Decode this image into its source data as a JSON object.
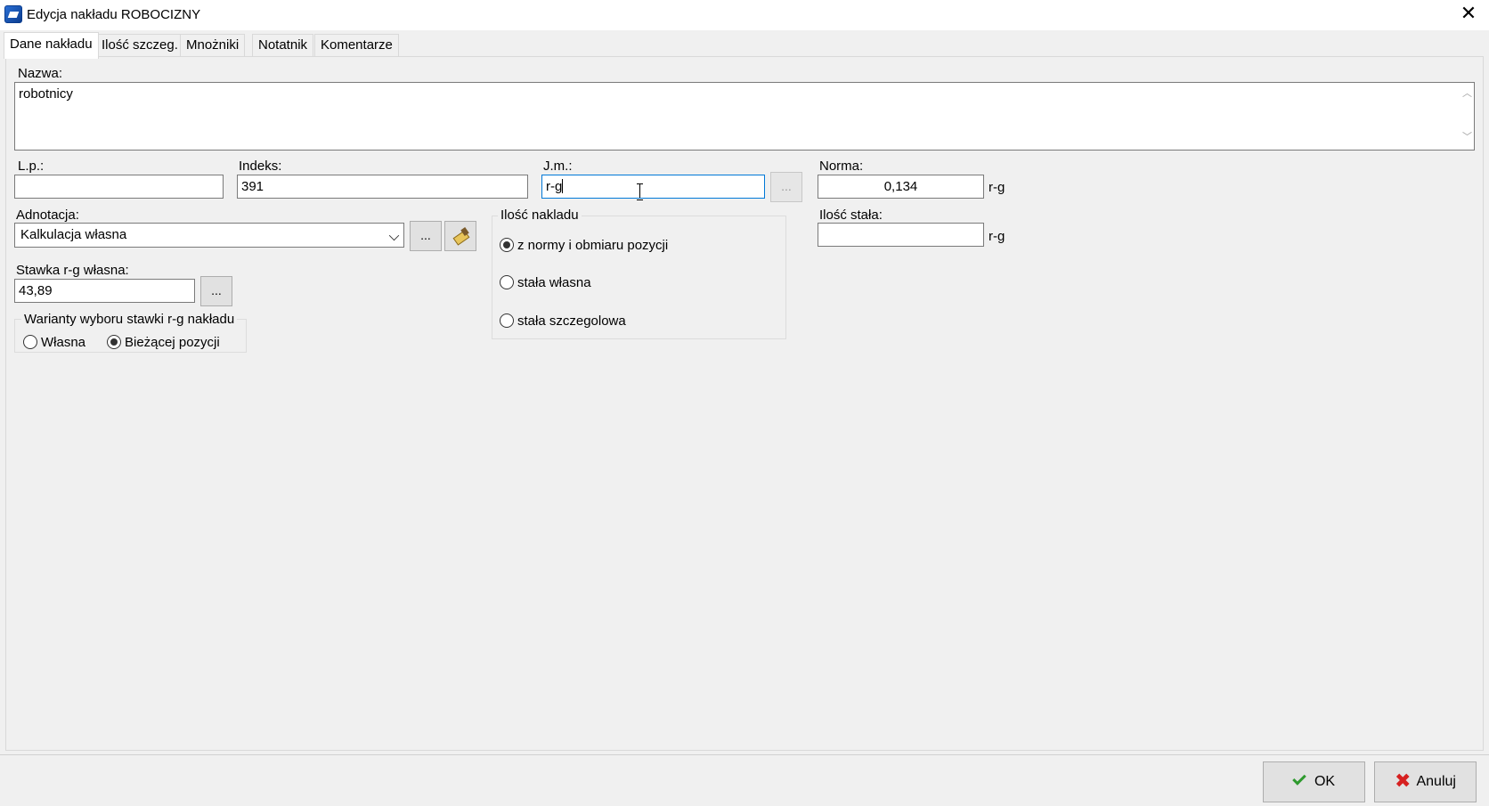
{
  "window": {
    "title": "Edycja nakładu ROBOCIZNY",
    "close": "✕"
  },
  "tabs": [
    {
      "label": "Dane nakładu",
      "active": true
    },
    {
      "label": "Ilość szczeg."
    },
    {
      "label": "Mnożniki"
    },
    {
      "label": "Notatnik"
    },
    {
      "label": "Komentarze"
    }
  ],
  "form": {
    "nazwa": {
      "label": "Nazwa:",
      "value": "robotnicy"
    },
    "lp": {
      "label": "L.p.:",
      "value": ""
    },
    "indeks": {
      "label": "Indeks:",
      "value": "391"
    },
    "jm": {
      "label": "J.m.:",
      "value": "r-g",
      "button": "..."
    },
    "norma": {
      "label": "Norma:",
      "value": "0,134",
      "unit": "r-g"
    },
    "adnotacja": {
      "label": "Adnotacja:",
      "value": "Kalkulacja własna",
      "button": "..."
    },
    "ilosc_stala": {
      "label": "Ilość stała:",
      "value": "",
      "unit": "r-g"
    },
    "stawka": {
      "label": "Stawka r-g własna:",
      "value": "43,89",
      "button": "..."
    },
    "warianty": {
      "title": "Warianty wyboru stawki r-g nakładu",
      "options": [
        {
          "label": "Własna",
          "checked": false
        },
        {
          "label": "Bieżącej pozycji",
          "checked": true
        }
      ]
    },
    "ilosc_nakladu": {
      "title": "Ilość nakladu",
      "options": [
        {
          "label": "z normy i obmiaru pozycji",
          "checked": true
        },
        {
          "label": "stała własna",
          "checked": false
        },
        {
          "label": "stała szczegolowa",
          "checked": false
        }
      ]
    }
  },
  "footer": {
    "ok": "OK",
    "cancel": "Anuluj"
  },
  "icons": {
    "app": "app-icon",
    "check": "check-icon",
    "x": "x-icon",
    "eraser": "eraser-icon"
  },
  "colors": {
    "ok_check": "#2e9a2e",
    "cancel_x": "#d62020",
    "focus": "#0078d7"
  }
}
